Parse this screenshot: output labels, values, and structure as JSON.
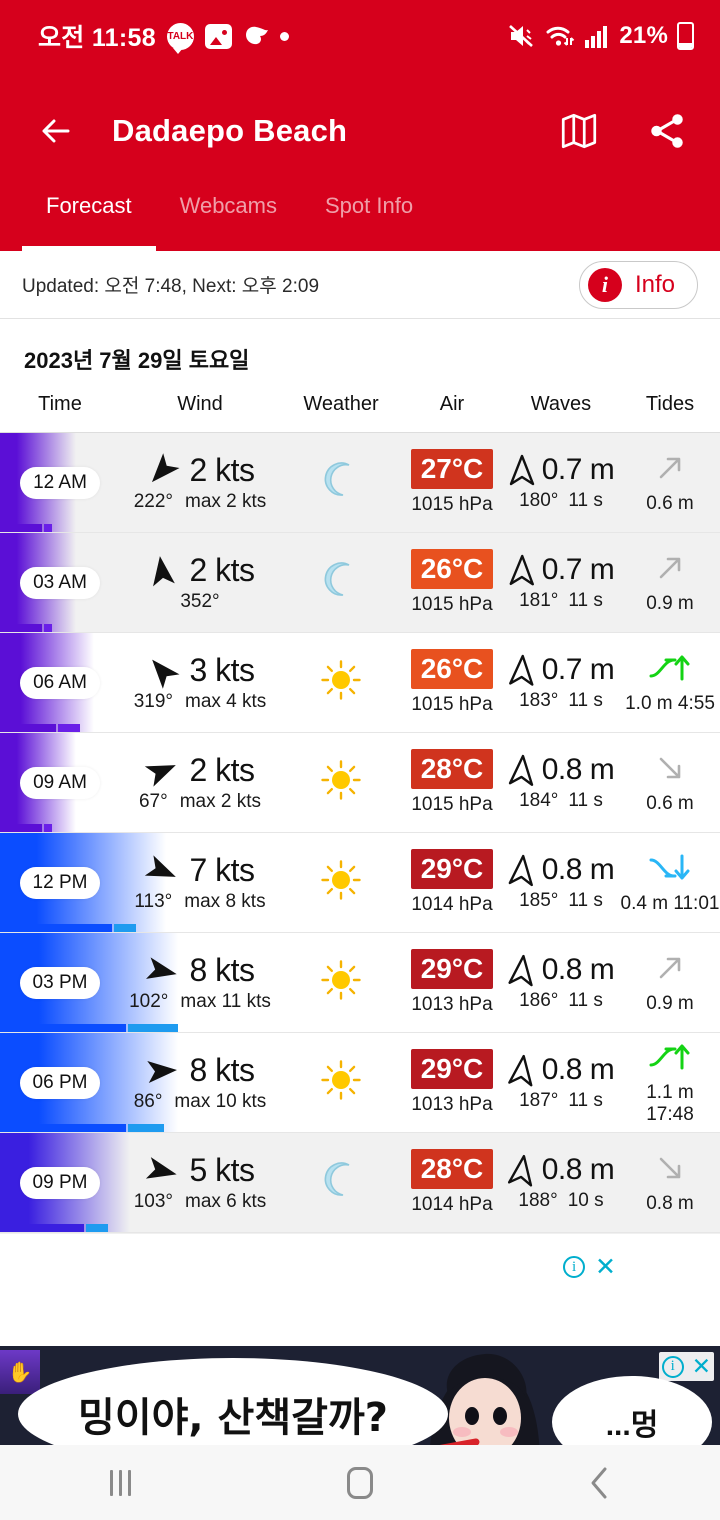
{
  "statusbar": {
    "time": "오전 11:58",
    "battery_percent": "21%",
    "icons_left": [
      "kakaotalk-icon",
      "photos-icon",
      "blob-icon",
      "dot-icon"
    ],
    "icons_right": [
      "mute-vibrate-icon",
      "wifi-icon",
      "signal-icon",
      "battery-icon"
    ]
  },
  "appbar": {
    "title": "Dadaepo Beach",
    "back_icon": "back-arrow-icon",
    "map_icon": "map-icon",
    "share_icon": "share-icon",
    "brand_color": "#D6001C"
  },
  "tabs": [
    {
      "label": "Forecast",
      "active": true
    },
    {
      "label": "Webcams",
      "active": false
    },
    {
      "label": "Spot Info",
      "active": false
    }
  ],
  "updated": {
    "text": "Updated: 오전 7:48, Next: 오후 2:09",
    "info_label": "Info",
    "info_icon": "info-icon"
  },
  "forecast": {
    "date": "2023년 7월 29일 토요일",
    "columns": [
      "Time",
      "Wind",
      "Weather",
      "Air",
      "Waves",
      "Tides"
    ],
    "rows": [
      {
        "time": "12 AM",
        "wind_speed": "2 kts",
        "wind_dir": "222°",
        "wind_gust": "max 2 kts",
        "wind_deg": 222,
        "wind_kts": 2,
        "gust_kts": 2,
        "weather": "moon-icon",
        "temp": "27°C",
        "temp_color": "#D0341E",
        "pressure": "1015 hPa",
        "wave_height": "0.7 m",
        "wave_dir": "180°",
        "wave_period": "11 s",
        "wave_deg": 180,
        "tide_icon": "tide-rising-icon",
        "tide_value": "0.6 m",
        "row_bg": "#f1f1f1"
      },
      {
        "time": "03 AM",
        "wind_speed": "2 kts",
        "wind_dir": "352°",
        "wind_gust": "",
        "wind_deg": 352,
        "wind_kts": 2,
        "gust_kts": 2,
        "weather": "moon-icon",
        "temp": "26°C",
        "temp_color": "#E8511F",
        "pressure": "1015 hPa",
        "wave_height": "0.7 m",
        "wave_dir": "181°",
        "wave_period": "11 s",
        "wave_deg": 181,
        "tide_icon": "tide-rising-icon",
        "tide_value": "0.9 m",
        "row_bg": "#f1f1f1"
      },
      {
        "time": "06 AM",
        "wind_speed": "3 kts",
        "wind_dir": "319°",
        "wind_gust": "max 4 kts",
        "wind_deg": 319,
        "wind_kts": 3,
        "gust_kts": 4,
        "weather": "sun-icon",
        "temp": "26°C",
        "temp_color": "#E8511F",
        "pressure": "1015 hPa",
        "wave_height": "0.7 m",
        "wave_dir": "183°",
        "wave_period": "11 s",
        "wave_deg": 183,
        "tide_icon": "tide-high-icon",
        "tide_value": "1.0 m 4:55",
        "row_bg": "#ffffff"
      },
      {
        "time": "09 AM",
        "wind_speed": "2 kts",
        "wind_dir": "67°",
        "wind_gust": "max 2 kts",
        "wind_deg": 67,
        "wind_kts": 2,
        "gust_kts": 2,
        "weather": "sun-icon",
        "temp": "28°C",
        "temp_color": "#D0341E",
        "pressure": "1015 hPa",
        "wave_height": "0.8 m",
        "wave_dir": "184°",
        "wave_period": "11 s",
        "wave_deg": 184,
        "tide_icon": "tide-falling-icon",
        "tide_value": "0.6 m",
        "row_bg": "#ffffff"
      },
      {
        "time": "12 PM",
        "wind_speed": "7 kts",
        "wind_dir": "113°",
        "wind_gust": "max 8 kts",
        "wind_deg": 113,
        "wind_kts": 7,
        "gust_kts": 8,
        "weather": "sun-icon",
        "temp": "29°C",
        "temp_color": "#B81A21",
        "pressure": "1014 hPa",
        "wave_height": "0.8 m",
        "wave_dir": "185°",
        "wave_period": "11 s",
        "wave_deg": 185,
        "tide_icon": "tide-low-icon",
        "tide_value": "0.4 m 11:01",
        "row_bg": "#ffffff"
      },
      {
        "time": "03 PM",
        "wind_speed": "8 kts",
        "wind_dir": "102°",
        "wind_gust": "max 11 kts",
        "wind_deg": 102,
        "wind_kts": 8,
        "gust_kts": 11,
        "weather": "sun-icon",
        "temp": "29°C",
        "temp_color": "#B81A21",
        "pressure": "1013 hPa",
        "wave_height": "0.8 m",
        "wave_dir": "186°",
        "wave_period": "11 s",
        "wave_deg": 186,
        "tide_icon": "tide-rising-icon",
        "tide_value": "0.9 m",
        "row_bg": "#ffffff"
      },
      {
        "time": "06 PM",
        "wind_speed": "8 kts",
        "wind_dir": "86°",
        "wind_gust": "max 10 kts",
        "wind_deg": 86,
        "wind_kts": 8,
        "gust_kts": 10,
        "weather": "sun-icon",
        "temp": "29°C",
        "temp_color": "#B81A21",
        "pressure": "1013 hPa",
        "wave_height": "0.8 m",
        "wave_dir": "187°",
        "wave_period": "11 s",
        "wave_deg": 187,
        "tide_icon": "tide-high-icon",
        "tide_value": "1.1 m 17:48",
        "row_bg": "#ffffff"
      },
      {
        "time": "09 PM",
        "wind_speed": "5 kts",
        "wind_dir": "103°",
        "wind_gust": "max 6 kts",
        "wind_deg": 103,
        "wind_kts": 5,
        "gust_kts": 6,
        "weather": "moon-icon",
        "temp": "28°C",
        "temp_color": "#D0341E",
        "pressure": "1014 hPa",
        "wave_height": "0.8 m",
        "wave_dir": "188°",
        "wave_period": "10 s",
        "wave_deg": 188,
        "tide_icon": "tide-falling-icon",
        "tide_value": "0.8 m",
        "row_bg": "#f1f1f1"
      }
    ]
  },
  "ad": {
    "info_icon": "ad-info-icon",
    "close_icon": "ad-close-icon",
    "close_label": "✕",
    "banner_text_main": "밍이야, 산책갈까?",
    "banner_text_small": "...멍"
  },
  "navbar": {
    "recent_icon": "recent-apps-icon",
    "home_icon": "home-icon",
    "back_icon": "nav-back-icon"
  }
}
